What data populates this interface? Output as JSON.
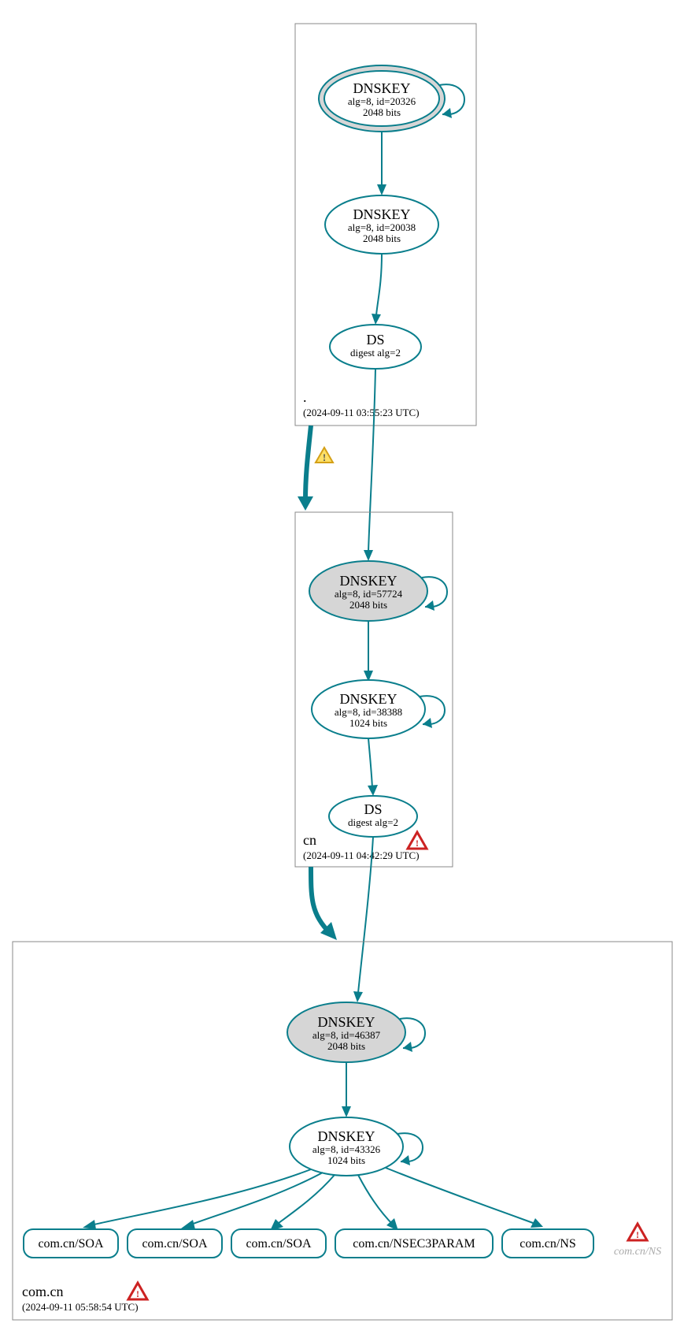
{
  "colors": {
    "stroke": "#0a7e8c",
    "fill_ksk": "#d6d6d6",
    "warn_stroke": "#d4a017",
    "warn_fill": "#ffe066",
    "error_stroke": "#cc2222",
    "error_fill": "#ffffff"
  },
  "zones": [
    {
      "name": ".",
      "timestamp": "(2024-09-11 03:55:23 UTC)",
      "error": false
    },
    {
      "name": "cn",
      "timestamp": "(2024-09-11 04:42:29 UTC)",
      "error": true
    },
    {
      "name": "com.cn",
      "timestamp": "(2024-09-11 05:58:54 UTC)",
      "error": true
    }
  ],
  "nodes": {
    "root_ksk": {
      "title": "DNSKEY",
      "line1": "alg=8, id=20326",
      "line2": "2048 bits"
    },
    "root_zsk": {
      "title": "DNSKEY",
      "line1": "alg=8, id=20038",
      "line2": "2048 bits"
    },
    "root_ds": {
      "title": "DS",
      "line1": "digest alg=2"
    },
    "cn_ksk": {
      "title": "DNSKEY",
      "line1": "alg=8, id=57724",
      "line2": "2048 bits"
    },
    "cn_zsk": {
      "title": "DNSKEY",
      "line1": "alg=8, id=38388",
      "line2": "1024 bits"
    },
    "cn_ds": {
      "title": "DS",
      "line1": "digest alg=2"
    },
    "comcn_ksk": {
      "title": "DNSKEY",
      "line1": "alg=8, id=46387",
      "line2": "2048 bits"
    },
    "comcn_zsk": {
      "title": "DNSKEY",
      "line1": "alg=8, id=43326",
      "line2": "1024 bits"
    }
  },
  "leaves": [
    {
      "label": "com.cn/SOA"
    },
    {
      "label": "com.cn/SOA"
    },
    {
      "label": "com.cn/SOA"
    },
    {
      "label": "com.cn/NSEC3PARAM"
    },
    {
      "label": "com.cn/NS"
    }
  ],
  "ghost": {
    "label": "com.cn/NS"
  }
}
